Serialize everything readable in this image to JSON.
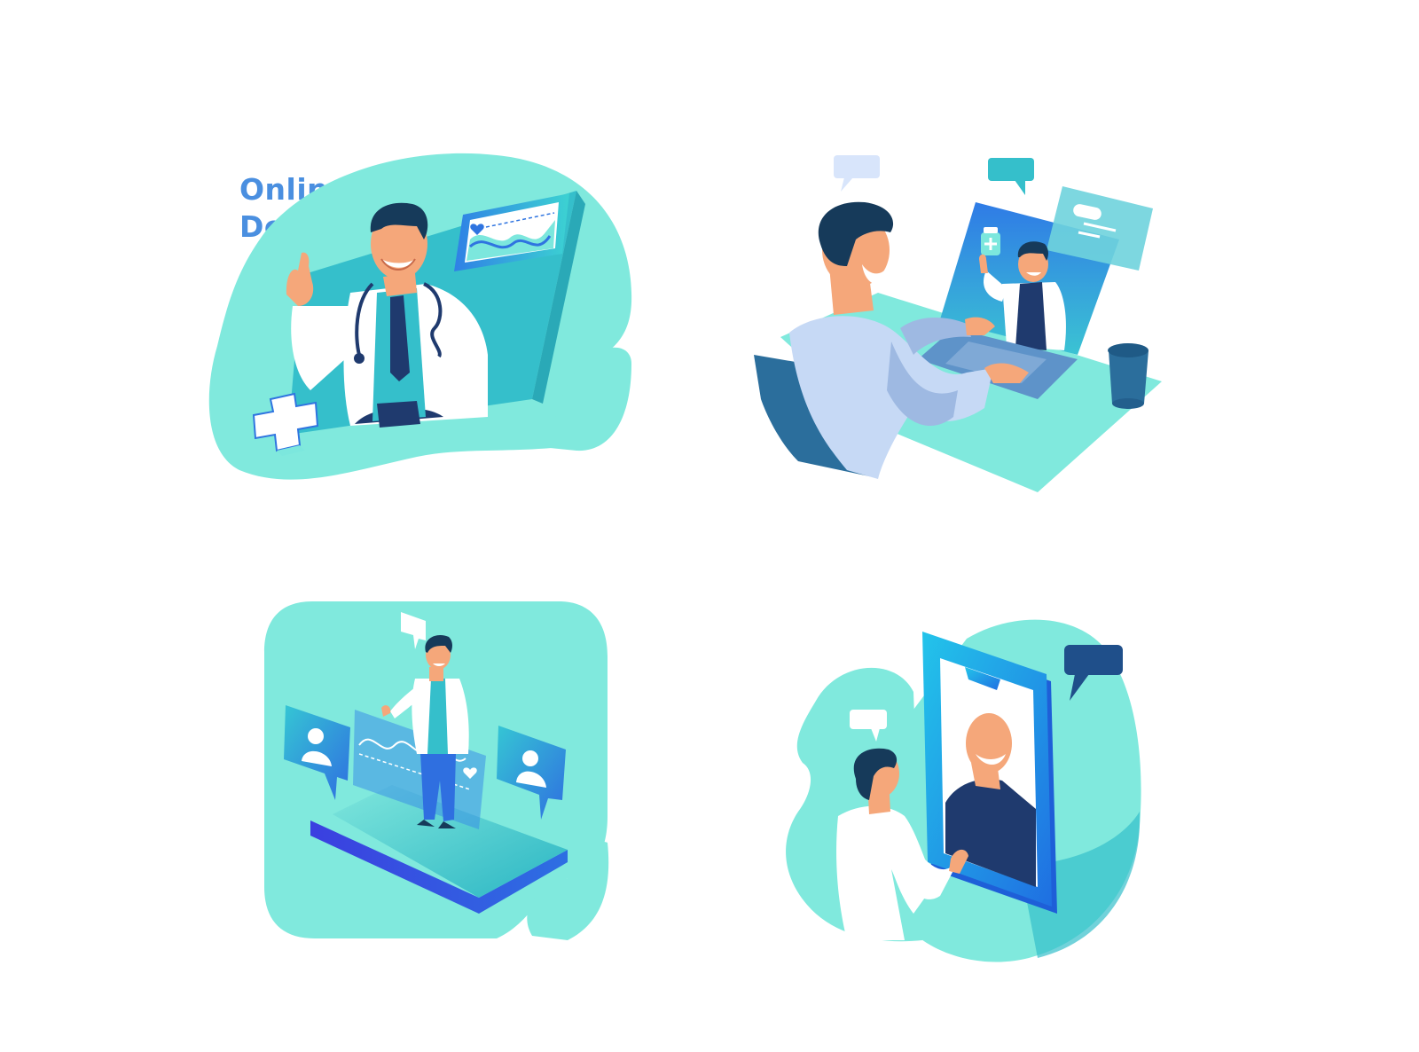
{
  "title": {
    "line1": "Online",
    "line2": "Doctor"
  },
  "colors": {
    "mint": "#80e9dd",
    "teal": "#35bfcb",
    "deep_teal": "#2aa9b7",
    "blue": "#2f74e0",
    "navy": "#1f3a6e",
    "hair": "#163a5a",
    "skin": "#f5a77a",
    "coat": "#ffffff",
    "title_text": "#4a8fe0"
  },
  "icons": [
    "plus-icon",
    "heart-icon",
    "chat-bubble-icon",
    "user-profile-icon",
    "pill-card-icon",
    "medicine-bottle-icon"
  ]
}
